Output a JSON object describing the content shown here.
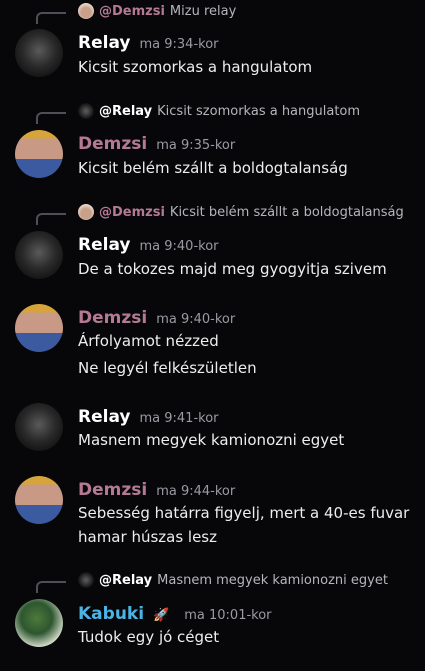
{
  "colors": {
    "relay": "#ffffff",
    "demzsi": "#b57a92",
    "kabuki": "#4bb4e6",
    "mention": "#b57a92"
  },
  "messages": [
    {
      "reply": {
        "name": "@Demzsi",
        "text": "Mizu relay"
      },
      "author": "Relay",
      "time": "ma 9:34-kor",
      "lines": [
        "Kicsit szomorkas a hangulatom"
      ]
    },
    {
      "reply": {
        "name": "@Relay",
        "text": "Kicsit szomorkas a hangulatom"
      },
      "author": "Demzsi",
      "time": "ma 9:35-kor",
      "lines": [
        "Kicsit belém szállt a boldogtalanság"
      ]
    },
    {
      "reply": {
        "name": "@Demzsi",
        "text": "Kicsit belém szállt a boldogtalanság"
      },
      "author": "Relay",
      "time": "ma 9:40-kor",
      "lines": [
        "De a tokozes majd meg gyogyitja szivem"
      ]
    },
    {
      "author": "Demzsi",
      "time": "ma 9:40-kor",
      "lines": [
        "Árfolyamot nézzed",
        "Ne legyél felkészületlen"
      ]
    },
    {
      "author": "Relay",
      "time": "ma 9:41-kor",
      "lines": [
        "Masnem megyek kamionozni egyet"
      ]
    },
    {
      "author": "Demzsi",
      "time": "ma 9:44-kor",
      "lines": [
        "Sebesség határra figyelj, mert a 40-es fuvar",
        "hamar húszas lesz"
      ]
    },
    {
      "reply": {
        "name": "@Relay",
        "text": "Masnem megyek kamionozni egyet"
      },
      "author": "Kabuki",
      "author_icon": "rocket-icon",
      "time": "ma 10:01-kor",
      "lines": [
        "Tudok egy jó céget"
      ]
    }
  ]
}
